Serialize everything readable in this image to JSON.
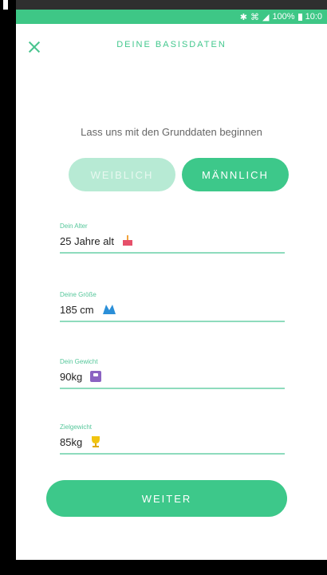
{
  "status": {
    "battery": "100%",
    "time": "10:0"
  },
  "header": {
    "title": "DEINE BASISDATEN"
  },
  "intro": {
    "text": "Lass uns mit den Grunddaten beginnen"
  },
  "gender": {
    "female": "WEIBLICH",
    "male": "MÄNNLICH",
    "selected": "male"
  },
  "fields": [
    {
      "label": "Dein Alter",
      "value": "25 Jahre alt",
      "icon": "cake-icon"
    },
    {
      "label": "Deine Größe",
      "value": "185 cm",
      "icon": "ruler-icon"
    },
    {
      "label": "Dein Gewicht",
      "value": "90kg",
      "icon": "scale-icon"
    },
    {
      "label": "Zielgewicht",
      "value": "85kg",
      "icon": "trophy-icon"
    }
  ],
  "cta": {
    "label": "WEITER"
  },
  "colors": {
    "accent": "#3dc88a",
    "accent_light": "#b7ead4",
    "underline": "#8edbbd"
  }
}
